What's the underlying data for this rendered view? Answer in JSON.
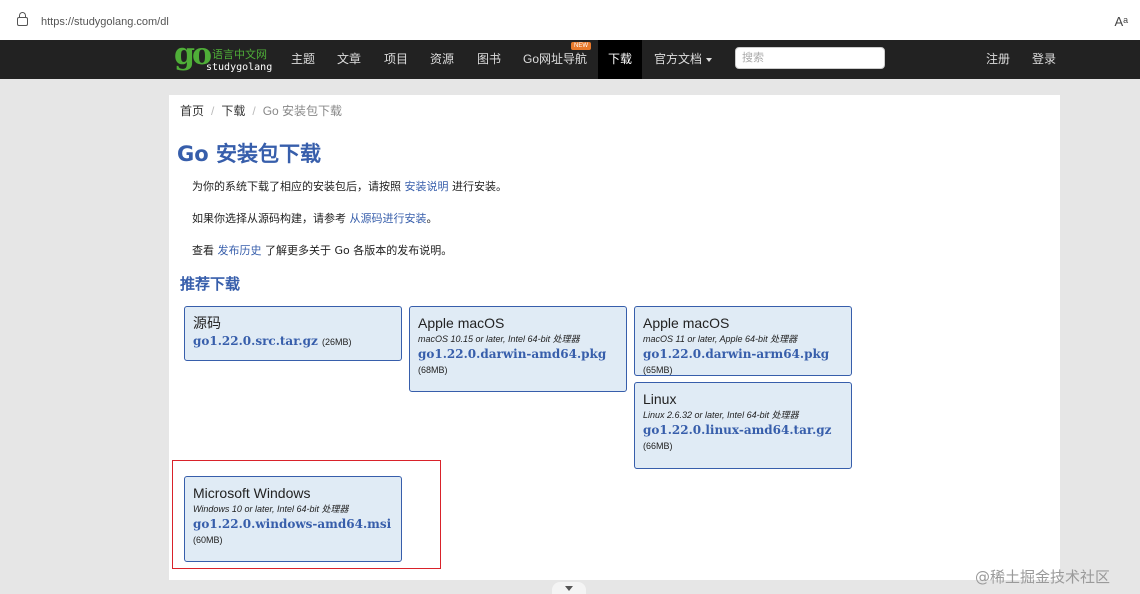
{
  "browser": {
    "url": "https://studygolang.com/dl",
    "read_aloud_icon": "Aᵃ"
  },
  "logo": {
    "go": "go",
    "cn": "语言中文网",
    "en": "studygolang"
  },
  "nav": {
    "items": [
      "主题",
      "文章",
      "项目",
      "资源",
      "图书",
      "Go网址导航",
      "下载",
      "官方文档"
    ],
    "new_badge": "NEW",
    "search_placeholder": "搜索",
    "register": "注册",
    "login": "登录"
  },
  "breadcrumb": {
    "home": "首页",
    "download": "下载",
    "current": "Go 安装包下载"
  },
  "page": {
    "title": "Go 安装包下载",
    "p1": {
      "pre": "为你的系统下载了相应的安装包后，请按照 ",
      "link": "安装说明",
      "post": " 进行安装。"
    },
    "p2": {
      "pre": "如果你选择从源码构建，请参考 ",
      "link": "从源码进行安装",
      "post": "。"
    },
    "p3": {
      "pre": "查看 ",
      "link": "发布历史",
      "post": " 了解更多关于 Go 各版本的发布说明。"
    },
    "recommended": "推荐下载"
  },
  "cards": [
    {
      "title": "源码",
      "subtitle": "",
      "file": "go1.22.0.src.tar.gz",
      "size": "(26MB)"
    },
    {
      "title": "Apple macOS",
      "subtitle": "macOS 10.15 or later, Intel 64-bit 处理器",
      "file": "go1.22.0.darwin-amd64.pkg",
      "size": "(68MB)"
    },
    {
      "title": "Apple macOS",
      "subtitle": "macOS 11 or later, Apple 64-bit 处理器",
      "file": "go1.22.0.darwin-arm64.pkg",
      "size": "(65MB)"
    },
    {
      "title": "Linux",
      "subtitle": "Linux 2.6.32 or later, Intel 64-bit 处理器",
      "file": "go1.22.0.linux-amd64.tar.gz",
      "size": "(66MB)"
    },
    {
      "title": "Microsoft Windows",
      "subtitle": "Windows 10 or later, Intel 64-bit 处理器",
      "file": "go1.22.0.windows-amd64.msi",
      "size": "(60MB)"
    }
  ],
  "watermark": "@稀土掘金技术社区",
  "colors": {
    "link": "#375eab",
    "card_bg": "#e0ebf5",
    "highlight": "#d9222a",
    "logo_green": "#4fae38",
    "nav_bg": "#222222"
  }
}
